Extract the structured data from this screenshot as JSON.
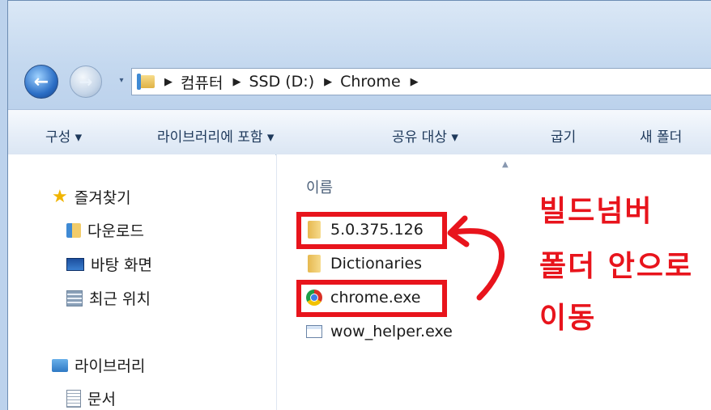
{
  "address": {
    "crumbs": [
      "컴퓨터",
      "SSD (D:)",
      "Chrome"
    ]
  },
  "toolbar": {
    "organize": "구성 ▾",
    "include_library": "라이브러리에 포함 ▾",
    "share_with": "공유 대상 ▾",
    "burn": "굽기",
    "new_folder": "새 폴더"
  },
  "nav_pane": {
    "favorites": "즐겨찾기",
    "downloads": "다운로드",
    "desktop": "바탕 화면",
    "recent": "최근 위치",
    "libraries": "라이브러리",
    "documents": "문서"
  },
  "content": {
    "column_header": "이름",
    "files": [
      {
        "name": "5.0.375.126",
        "type": "folder"
      },
      {
        "name": "Dictionaries",
        "type": "folder"
      },
      {
        "name": "chrome.exe",
        "type": "chrome-exe"
      },
      {
        "name": "wow_helper.exe",
        "type": "exe"
      }
    ]
  },
  "annotation": {
    "line1": "빌드넘버",
    "line2": "폴더 안으로",
    "line3": "이동",
    "color": "#e8141c"
  }
}
